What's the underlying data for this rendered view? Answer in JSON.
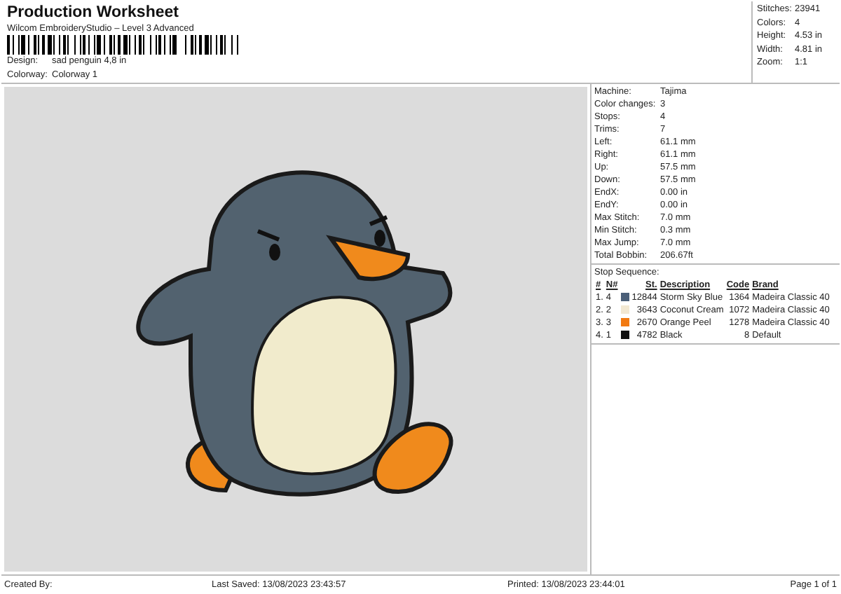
{
  "header": {
    "title": "Production Worksheet",
    "subtitle": "Wilcom EmbroideryStudio – Level 3 Advanced",
    "fields": [
      {
        "label": "Design:",
        "value": "sad penguin 4,8 in"
      },
      {
        "label": "Colorway:",
        "value": "Colorway 1"
      }
    ]
  },
  "summary": [
    {
      "label": "Stitches:",
      "value": "23941"
    },
    {
      "label": "Colors:",
      "value": "4"
    },
    {
      "label": "Height:",
      "value": "4.53 in"
    },
    {
      "label": "Width:",
      "value": "4.81 in"
    },
    {
      "label": "Zoom:",
      "value": "1:1"
    }
  ],
  "details": [
    {
      "label": "Machine:",
      "value": "Tajima"
    },
    {
      "label": "Color changes:",
      "value": "3"
    },
    {
      "label": "Stops:",
      "value": "4"
    },
    {
      "label": "Trims:",
      "value": "7"
    },
    {
      "label": "Left:",
      "value": "61.1 mm"
    },
    {
      "label": "Right:",
      "value": "61.1 mm"
    },
    {
      "label": "Up:",
      "value": "57.5 mm"
    },
    {
      "label": "Down:",
      "value": "57.5 mm"
    },
    {
      "label": "EndX:",
      "value": "0.00 in"
    },
    {
      "label": "EndY:",
      "value": "0.00 in"
    },
    {
      "label": "Max Stitch:",
      "value": "7.0 mm"
    },
    {
      "label": "Min Stitch:",
      "value": "0.3 mm"
    },
    {
      "label": "Max Jump:",
      "value": "7.0 mm"
    },
    {
      "label": "Total Bobbin:",
      "value": "206.67ft"
    }
  ],
  "stop_sequence": {
    "title": "Stop Sequence:",
    "columns": [
      "#",
      "N#",
      "St.",
      "Description",
      "Code",
      "Brand"
    ],
    "rows": [
      {
        "index": "1.",
        "number": "4",
        "color": "#4b5f78",
        "stitches": "12844",
        "description": "Storm Sky Blue",
        "code": "1364",
        "brand": "Madeira Classic 40"
      },
      {
        "index": "2.",
        "number": "2",
        "color": "#f2e8d2",
        "stitches": "3643",
        "description": "Coconut Cream",
        "code": "1072",
        "brand": "Madeira Classic 40"
      },
      {
        "index": "3.",
        "number": "3",
        "color": "#f27a12",
        "stitches": "2670",
        "description": "Orange Peel",
        "code": "1278",
        "brand": "Madeira Classic 40"
      },
      {
        "index": "4.",
        "number": "1",
        "color": "#111111",
        "stitches": "4782",
        "description": "Black",
        "code": "8",
        "brand": "Default"
      }
    ]
  },
  "footer": {
    "created": "Created By:",
    "saved": "Last Saved: 13/08/2023 23:43:57",
    "printed": "Printed: 13/08/2023 23:44:01",
    "page": "Page 1 of 1"
  }
}
